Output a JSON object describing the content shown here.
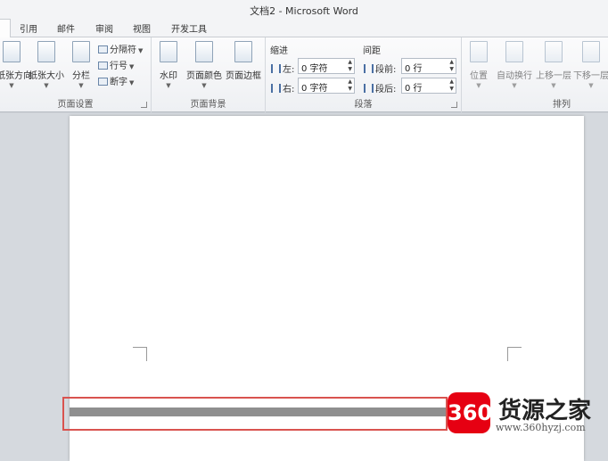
{
  "window": {
    "title": "文档2 - Microsoft Word"
  },
  "tabs": [
    "引用",
    "邮件",
    "审阅",
    "视图",
    "开发工具"
  ],
  "page_setup": {
    "label": "页面设置",
    "orientation": "纸张方向",
    "size": "纸张大小",
    "columns": "分栏",
    "breaks": "分隔符",
    "line_numbers": "行号",
    "hyphenation": "断字"
  },
  "page_background": {
    "label": "页面背景",
    "watermark": "水印",
    "page_color": "页面颜色",
    "page_borders": "页面边框"
  },
  "paragraph": {
    "label": "段落",
    "indent_title": "缩进",
    "indent_left_label": "左:",
    "indent_left_value": "0 字符",
    "indent_right_label": "右:",
    "indent_right_value": "0 字符",
    "spacing_title": "间距",
    "spacing_before_label": "段前:",
    "spacing_before_value": "0 行",
    "spacing_after_label": "段后:",
    "spacing_after_value": "0 行"
  },
  "arrange": {
    "label": "排列",
    "position": "位置",
    "wrap_text": "自动换行",
    "bring_forward": "上移一层",
    "send_backward": "下移一层"
  },
  "watermark": {
    "badge": "360",
    "name": "货源之家",
    "url": "www.360hyzj.com"
  }
}
